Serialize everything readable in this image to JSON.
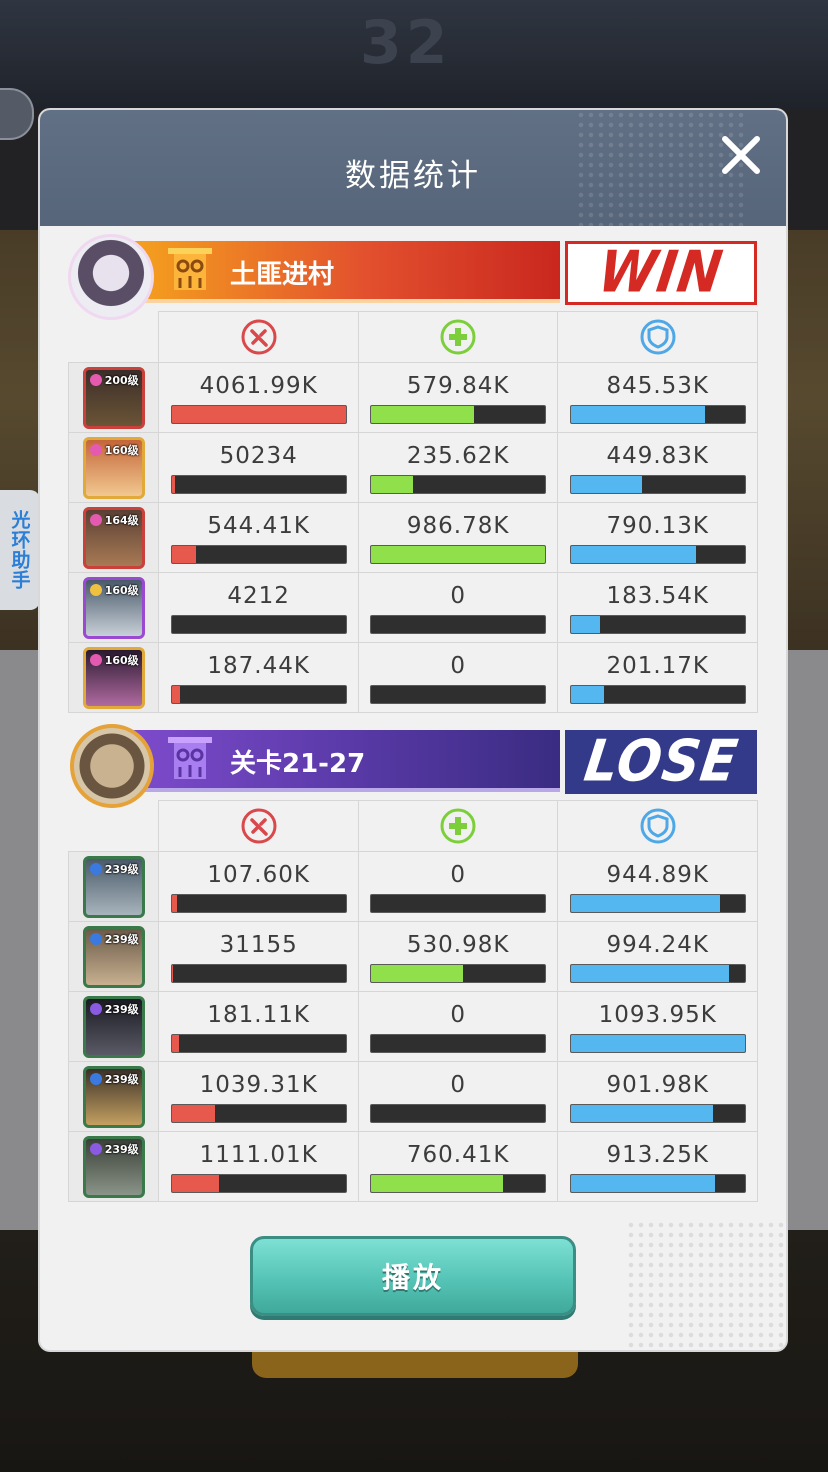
{
  "dialog": {
    "title": "数据统计",
    "play_label": "播放"
  },
  "side_tab": {
    "label": "光环助手"
  },
  "background": {
    "score_text": "32"
  },
  "stat_icons": [
    "damage-icon",
    "heal-icon",
    "shield-icon"
  ],
  "colors": {
    "damage": "#e7594d",
    "heal": "#8fe04a",
    "shield": "#55b7f0",
    "win": "#d42a23",
    "lose": "#343a8a"
  },
  "team_win": {
    "name": "土匪进村",
    "result": "WIN",
    "rows": [
      {
        "level": "200级",
        "damage": "4061.99K",
        "heal": "579.84K",
        "shield": "845.53K",
        "damage_pct": 100,
        "heal_pct": 59,
        "shield_pct": 77
      },
      {
        "level": "160级",
        "damage": "50234",
        "heal": "235.62K",
        "shield": "449.83K",
        "damage_pct": 2,
        "heal_pct": 24,
        "shield_pct": 41
      },
      {
        "level": "164级",
        "damage": "544.41K",
        "heal": "986.78K",
        "shield": "790.13K",
        "damage_pct": 14,
        "heal_pct": 100,
        "shield_pct": 72
      },
      {
        "level": "160级",
        "damage": "4212",
        "heal": "0",
        "shield": "183.54K",
        "damage_pct": 0,
        "heal_pct": 0,
        "shield_pct": 17
      },
      {
        "level": "160级",
        "damage": "187.44K",
        "heal": "0",
        "shield": "201.17K",
        "damage_pct": 5,
        "heal_pct": 0,
        "shield_pct": 19
      }
    ]
  },
  "team_lose": {
    "name": "关卡21-27",
    "result": "LOSE",
    "rows": [
      {
        "level": "239级",
        "damage": "107.60K",
        "heal": "0",
        "shield": "944.89K",
        "damage_pct": 3,
        "heal_pct": 0,
        "shield_pct": 86
      },
      {
        "level": "239级",
        "damage": "31155",
        "heal": "530.98K",
        "shield": "994.24K",
        "damage_pct": 1,
        "heal_pct": 53,
        "shield_pct": 91
      },
      {
        "level": "239级",
        "damage": "181.11K",
        "heal": "0",
        "shield": "1093.95K",
        "damage_pct": 4,
        "heal_pct": 0,
        "shield_pct": 100
      },
      {
        "level": "239级",
        "damage": "1039.31K",
        "heal": "0",
        "shield": "901.98K",
        "damage_pct": 25,
        "heal_pct": 0,
        "shield_pct": 82
      },
      {
        "level": "239级",
        "damage": "1111.01K",
        "heal": "760.41K",
        "shield": "913.25K",
        "damage_pct": 27,
        "heal_pct": 76,
        "shield_pct": 83
      }
    ]
  }
}
